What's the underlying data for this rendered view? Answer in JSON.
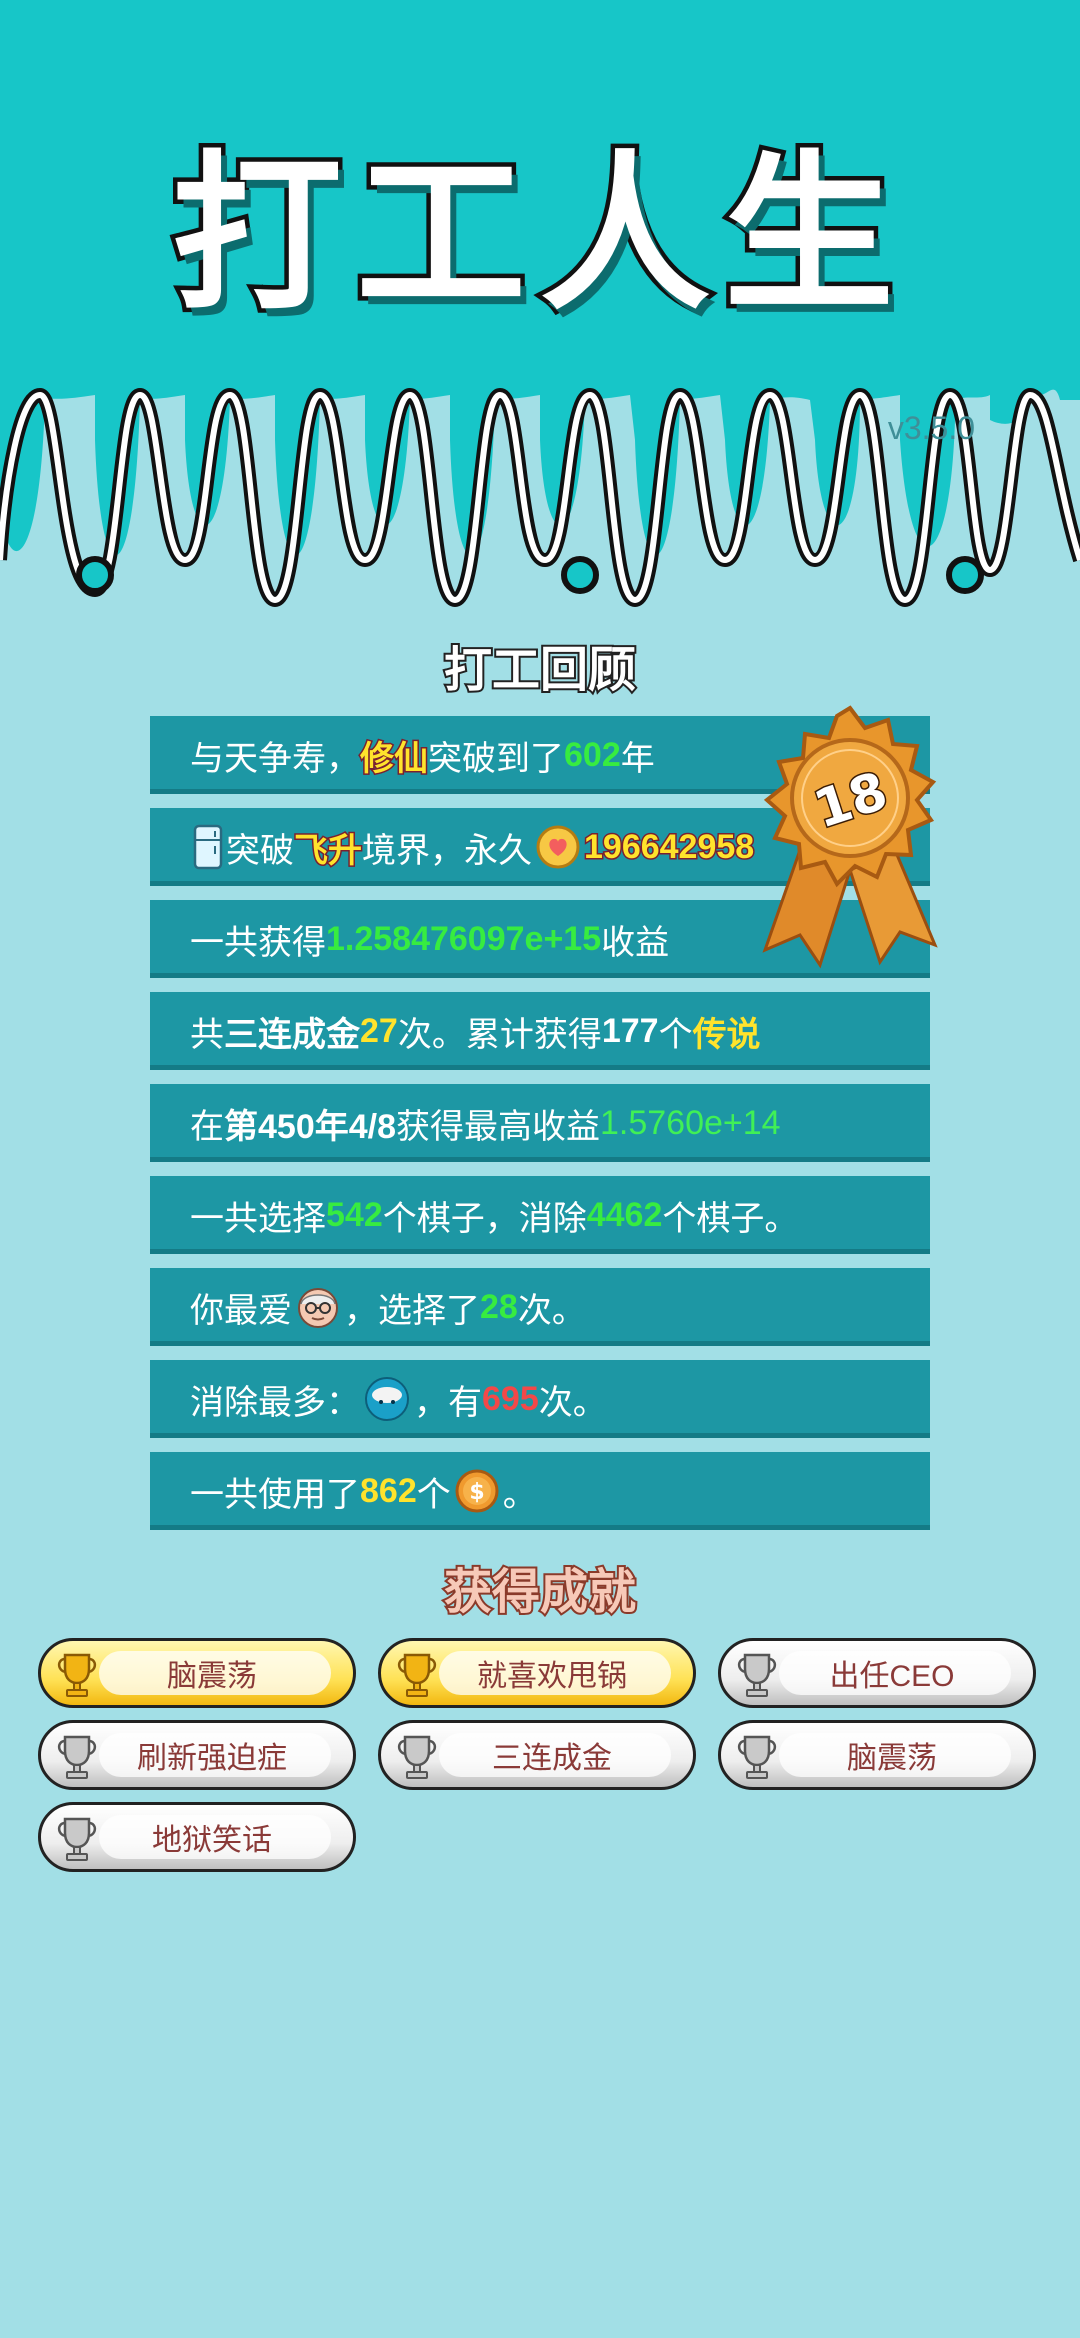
{
  "app": {
    "title": "打工人生",
    "version": "v3.5.0"
  },
  "review": {
    "heading": "打工回顾",
    "badge_number": "18",
    "stats": [
      {
        "parts": [
          {
            "t": "与天争寿，"
          },
          {
            "t": "修仙",
            "c": "tag"
          },
          {
            "t": "突破到了"
          },
          {
            "t": "602",
            "c": "g"
          },
          {
            "t": "年"
          }
        ]
      },
      {
        "parts": [
          {
            "icon": "fridge-icon"
          },
          {
            "t": "突破"
          },
          {
            "t": "飞升",
            "c": "tag"
          },
          {
            "t": "境界，永久"
          },
          {
            "icon": "heart-coin-icon"
          },
          {
            "t": "196642958",
            "c": "tag"
          }
        ]
      },
      {
        "parts": [
          {
            "t": "一共获得"
          },
          {
            "t": "1.258476097e+15",
            "c": "g"
          },
          {
            "t": "收益"
          }
        ]
      },
      {
        "parts": [
          {
            "t": "共"
          },
          {
            "t": "三连成金",
            "c": "w"
          },
          {
            "t": "27",
            "c": "y"
          },
          {
            "t": "次。累计获得"
          },
          {
            "t": "177",
            "c": "w"
          },
          {
            "t": "个"
          },
          {
            "t": "传说",
            "c": "y"
          }
        ]
      },
      {
        "parts": [
          {
            "t": "在 "
          },
          {
            "t": "第450年4/8",
            "c": "w"
          },
          {
            "t": " 获得最高收益"
          },
          {
            "t": "1.5760e+14",
            "c": "g2"
          }
        ]
      },
      {
        "parts": [
          {
            "t": "一共选择"
          },
          {
            "t": "542",
            "c": "g"
          },
          {
            "t": "个棋子，消除"
          },
          {
            "t": "4462",
            "c": "g"
          },
          {
            "t": "个棋子。"
          }
        ]
      },
      {
        "parts": [
          {
            "t": "你最爱"
          },
          {
            "icon": "old-man-face-icon"
          },
          {
            "t": "，选择了"
          },
          {
            "t": "28",
            "c": "g"
          },
          {
            "t": "次。"
          }
        ]
      },
      {
        "parts": [
          {
            "t": "消除最多："
          },
          {
            "icon": "rice-bowl-icon"
          },
          {
            "t": "，有"
          },
          {
            "t": "695",
            "c": "r"
          },
          {
            "t": "次。"
          }
        ]
      },
      {
        "parts": [
          {
            "t": "一共使用了"
          },
          {
            "t": "862",
            "c": "y"
          },
          {
            "t": "个"
          },
          {
            "icon": "dollar-coin-icon"
          },
          {
            "t": "。"
          }
        ]
      }
    ]
  },
  "achievements": {
    "heading": "获得成就",
    "items": [
      {
        "label": "脑震荡",
        "unlocked": true
      },
      {
        "label": "就喜欢甩锅",
        "unlocked": true
      },
      {
        "label": "出任CEO",
        "unlocked": false
      },
      {
        "label": "刷新强迫症",
        "unlocked": false
      },
      {
        "label": "三连成金",
        "unlocked": false
      },
      {
        "label": "脑震荡",
        "unlocked": false
      },
      {
        "label": "地狱笑话",
        "unlocked": false
      }
    ]
  },
  "colors": {
    "header_bg": "#17c6c8",
    "page_bg": "#a2dfe6",
    "row_bg": "#1d97a4",
    "highlight_green": "#37ec40",
    "highlight_yellow": "#ffe32c",
    "highlight_red": "#f34848"
  }
}
